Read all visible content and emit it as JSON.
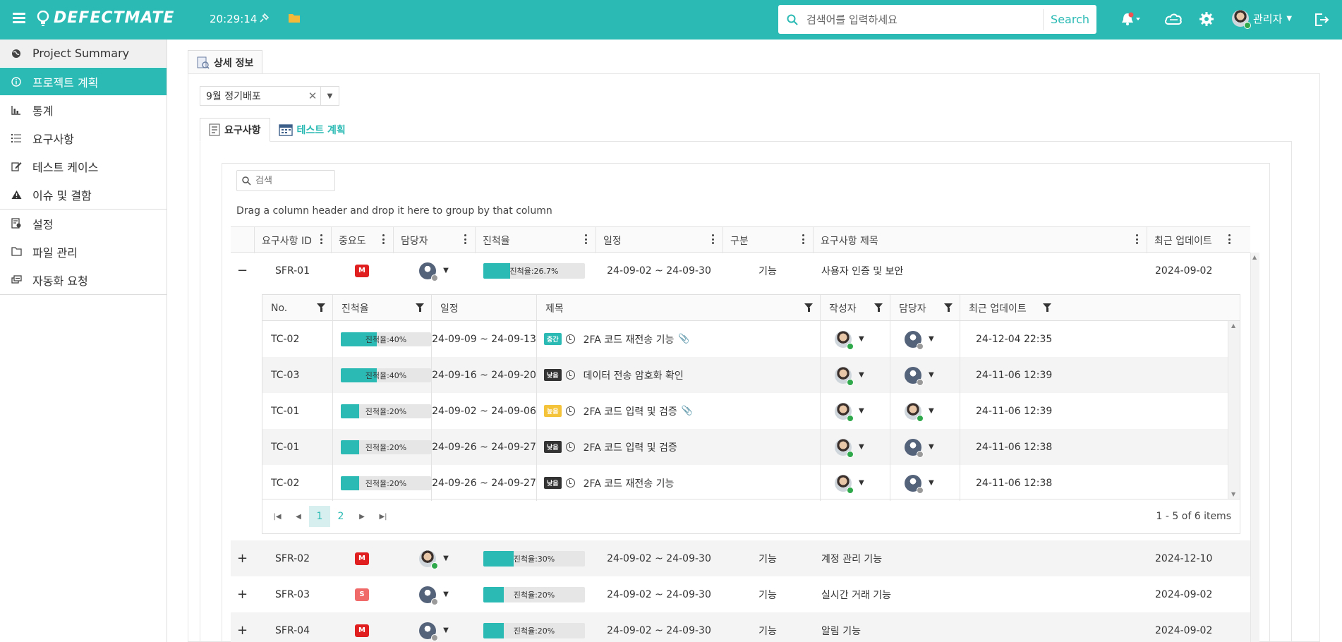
{
  "header": {
    "logo": "DEFECTMATE",
    "time": "20:29:14",
    "search_placeholder": "검색어를 입력하세요",
    "search_button": "Search",
    "user_name": "관리자"
  },
  "sidebar": {
    "items": [
      {
        "label": "Project Summary",
        "icon": "globe-icon"
      },
      {
        "label": "프로젝트 계획",
        "icon": "info-icon"
      },
      {
        "label": "통계",
        "icon": "chart-icon"
      },
      {
        "label": "요구사항",
        "icon": "list-icon"
      },
      {
        "label": "테스트 케이스",
        "icon": "edit-icon"
      },
      {
        "label": "이슈 및 결함",
        "icon": "warning-icon"
      },
      {
        "label": "설정",
        "icon": "settings-doc-icon"
      },
      {
        "label": "파일 관리",
        "icon": "folder-icon"
      },
      {
        "label": "자동화 요청",
        "icon": "automation-icon"
      }
    ]
  },
  "main": {
    "tab_label": "상세 정보",
    "release_value": "9월 정기배포",
    "subtabs": [
      "요구사항",
      "테스트 계획"
    ],
    "grid_search_placeholder": "검색",
    "group_hint": "Drag a column header and drop it here to group by that column"
  },
  "master": {
    "columns": [
      "요구사항 ID",
      "중요도",
      "담당자",
      "진척율",
      "일정",
      "구분",
      "요구사항 제목",
      "최근 업데이트"
    ],
    "rows": [
      {
        "expander": "−",
        "id": "SFR-01",
        "priority": "M",
        "assignee": "blank",
        "progress_label": "진척율:26.7%",
        "progress": 26.7,
        "schedule": "24-09-02 ~ 24-09-30",
        "type": "기능",
        "title": "사용자 인증 및 보안",
        "updated": "2024-09-02"
      },
      {
        "expander": "+",
        "id": "SFR-02",
        "priority": "M",
        "assignee": "photo",
        "progress_label": "진척율:30%",
        "progress": 30,
        "schedule": "24-09-02 ~ 24-09-30",
        "type": "기능",
        "title": "계정 관리 기능",
        "updated": "2024-12-10"
      },
      {
        "expander": "+",
        "id": "SFR-03",
        "priority": "S",
        "assignee": "blank",
        "progress_label": "진척율:20%",
        "progress": 20,
        "schedule": "24-09-02 ~ 24-09-30",
        "type": "기능",
        "title": "실시간 거래 기능",
        "updated": "2024-09-02"
      },
      {
        "expander": "+",
        "id": "SFR-04",
        "priority": "M",
        "assignee": "blank",
        "progress_label": "진척율:20%",
        "progress": 20,
        "schedule": "24-09-02 ~ 24-09-30",
        "type": "기능",
        "title": "알림 기능",
        "updated": "2024-09-02"
      }
    ]
  },
  "detail": {
    "columns": [
      "No.",
      "진척율",
      "일정",
      "제목",
      "작성자",
      "담당자",
      "최근 업데이트"
    ],
    "rows": [
      {
        "no": "TC-02",
        "progress_label": "진척율:40%",
        "progress": 40,
        "schedule": "24-09-09 ~ 24-09-13",
        "tag": "중간",
        "tag_kind": "mid",
        "title": "2FA 코드 재전송 기능",
        "attach": true,
        "writer": "photo",
        "assignee": "blank",
        "updated": "24-12-04 22:35"
      },
      {
        "no": "TC-03",
        "progress_label": "진척율:40%",
        "progress": 40,
        "schedule": "24-09-16 ~ 24-09-20",
        "tag": "낮음",
        "tag_kind": "low",
        "title": "데이터 전송 암호화 확인",
        "attach": false,
        "writer": "photo",
        "assignee": "blank",
        "updated": "24-11-06 12:39"
      },
      {
        "no": "TC-01",
        "progress_label": "진척율:20%",
        "progress": 20,
        "schedule": "24-09-02 ~ 24-09-06",
        "tag": "높음",
        "tag_kind": "high",
        "title": "2FA 코드 입력 및 검증",
        "attach": true,
        "writer": "photo",
        "assignee": "photo",
        "updated": "24-11-06 12:39"
      },
      {
        "no": "TC-01",
        "progress_label": "진척율:20%",
        "progress": 20,
        "schedule": "24-09-26 ~ 24-09-27",
        "tag": "낮음",
        "tag_kind": "low",
        "title": "2FA 코드 입력 및 검증",
        "attach": false,
        "writer": "photo",
        "assignee": "blank",
        "updated": "24-11-06 12:38"
      },
      {
        "no": "TC-02",
        "progress_label": "진척율:20%",
        "progress": 20,
        "schedule": "24-09-26 ~ 24-09-27",
        "tag": "낮음",
        "tag_kind": "low",
        "title": "2FA 코드 재전송 기능",
        "attach": false,
        "writer": "photo",
        "assignee": "blank",
        "updated": "24-11-06 12:38"
      }
    ],
    "pages": [
      "1",
      "2"
    ],
    "current_page": "1",
    "pager_info": "1 - 5 of 6 items"
  },
  "colors": {
    "accent": "#2bbab4",
    "priority_m": "#e02020",
    "priority_s": "#f06a6a",
    "online": "#2ea84a"
  }
}
